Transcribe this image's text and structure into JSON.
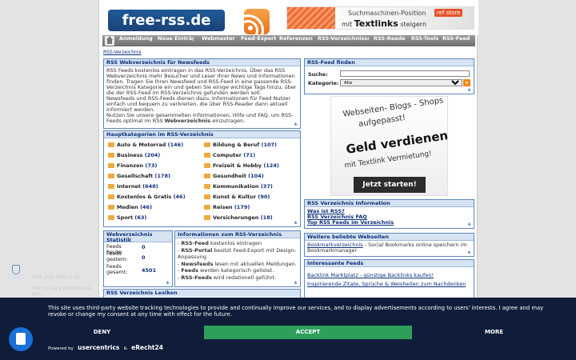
{
  "header": {
    "logo_text": "free-rss.de",
    "banner_line1": "Suchmaschinen-Position",
    "banner_mit": "mit",
    "banner_brand": "Textlinks",
    "banner_end": "steigern",
    "banner_badge": "ref store"
  },
  "nav": {
    "items": [
      "Anmeldung",
      "Neue Einträge",
      "Webmaster",
      "Feed-Export",
      "Referenzen",
      "RSS-Verzeichnisse",
      "RSS-Reader",
      "RSS-Tools",
      "RSS-Feed"
    ]
  },
  "breadcrumb": "RSS-Verzeichnis",
  "intro": {
    "title": "RSS Webverzeichnis für Newsfeeds",
    "p1": "RSS Feeds kostenlos eintragen in das RSS-Verzeichnis. Über das RSS Webverzeichnis mehr Besucher und Leser Ihrer News und Informationen finden. Tragen Sie Ihren Newsfeed und RSS-Feed in eine passende RSS-Verzeichnis Kategorie ein und geben Sie einige wichtige Tags hinzu, über die der RSS-Feed im RSS-Verzeichnis gefunden werden soll.",
    "p2": "Newsfeeds und RSS-Feeds dienen dazu, Informationen für Feed Nutzer einfach und bequem zu verbreiten, die über RSS-Reader dann aktuell informiert werden.",
    "p3_a": "Nutzen Sie unsere gesammelten Informationen, Hilfe und FAQ, um RSS-Feeds optimal im RSS ",
    "p3_b": "Webverzeichnis",
    "p3_c": " einzutragen."
  },
  "categories": {
    "title": "Hauptkategorien im RSS-Verzeichnis",
    "left": [
      {
        "name": "Auto & Motorrad",
        "count": "(146)"
      },
      {
        "name": "Business",
        "count": "(204)"
      },
      {
        "name": "Finanzen",
        "count": "(73)"
      },
      {
        "name": "Gesellschaft",
        "count": "(178)"
      },
      {
        "name": "Internet",
        "count": "(648)"
      },
      {
        "name": "Kostenlos & Gratis",
        "count": "(46)"
      },
      {
        "name": "Medien",
        "count": "(46)"
      },
      {
        "name": "Sport",
        "count": "(63)"
      }
    ],
    "right": [
      {
        "name": "Bildung & Beruf",
        "count": "(107)"
      },
      {
        "name": "Computer",
        "count": "(71)"
      },
      {
        "name": "Freizeit & Hobby",
        "count": "(124)"
      },
      {
        "name": "Gesundheit",
        "count": "(104)"
      },
      {
        "name": "Kommunikation",
        "count": "(37)"
      },
      {
        "name": "Kunst & Kultur",
        "count": "(90)"
      },
      {
        "name": "Reisen",
        "count": "(179)"
      },
      {
        "name": "Versicherungen",
        "count": "(18)"
      }
    ]
  },
  "stats": {
    "title": "Webverzeichnis Statistik",
    "rows": [
      {
        "label": "Feeds heute:",
        "value": "0"
      },
      {
        "label": "Feeds gestern:",
        "value": "0"
      },
      {
        "label": "Feeds gesamt:",
        "value": "4501"
      }
    ]
  },
  "info": {
    "title": "Informationen zum RSS-Verzeichnis",
    "items": [
      {
        "bold": "RSS-Feed",
        "text": " kostenlos eintragen"
      },
      {
        "bold": "RSS-Portal",
        "text": " besitzt Feed-Export mit Design-Anpassung."
      },
      {
        "bold": "Newsfeeds",
        "text": " lesen mit aktuellen Meldungen."
      },
      {
        "bold": "Feeds",
        "text": " werden kategorisch gelistet."
      },
      {
        "bold": "RSS-Feeds",
        "text": " wird redationell geführt."
      }
    ]
  },
  "lexikon": {
    "title": "RSS Verzeichnis Lexikon"
  },
  "search": {
    "title": "RSS-Feed finden",
    "search_label": "Suche:",
    "search_value": "",
    "category_label": "Kategorie:",
    "category_selected": "Alle"
  },
  "ad": {
    "line1": "Webseiten- Blogs - Shops",
    "line2": "aufgepasst!",
    "line3": "Geld verdienen",
    "line4": "mit Textlink Vermietung!",
    "button": "Jetzt starten!"
  },
  "rss_info": {
    "title": "RSS Verzeichnis Information",
    "links": [
      "Was ist RSS?",
      "RSS Verzeichnis FAQ",
      "Top RSS Feeds im Verzeichnis"
    ]
  },
  "websites": {
    "title": "Weitere beliebte Webseiten",
    "link": "Bookmarkverzeichnis",
    "text": " - Social Bookmarks online speichern im Bookmarkmanager"
  },
  "feeds": {
    "title": "Interessante Feeds",
    "links": [
      "Backlink Marktplatz - günstige Backlinks kaufen!",
      "Inspirierende Zitate, Sprüche & Weisheiten zum Nachdenken"
    ]
  },
  "cookie": {
    "ghost_title": "How your data is us",
    "ghost_text": "Your privacy preferences are",
    "text": "This site uses third-party website tracking technologies to provide and continually improve our services, and to display advertisements according to users' interests. I agree and may revoke or change my consent at any time with effect for the future.",
    "deny": "DENY",
    "accept": "ACCEPT",
    "more": "MORE",
    "powered_by": "Powered by",
    "brand1": "usercentrics",
    "amp": "&",
    "brand2": "eRecht24"
  },
  "colors": {
    "accent": "#0b2f7a",
    "box_border": "#5f86bd",
    "cookie_bg": "#0f1d3a",
    "accept": "#2f9e5a",
    "rss_orange": "#e7731e"
  }
}
